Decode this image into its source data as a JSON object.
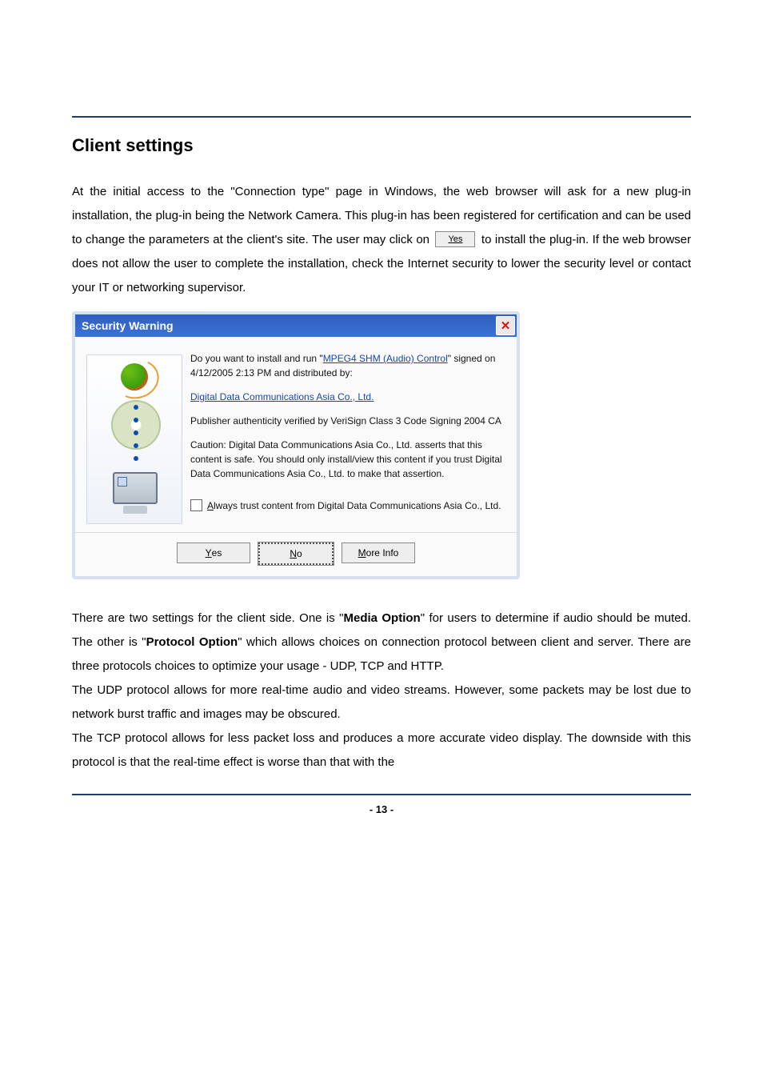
{
  "heading": "Client settings",
  "intro_before_button": "At the initial access to the \"Connection type\" page in Windows, the web browser will ask for a new plug-in installation, the plug-in being the Network Camera. This plug-in has been registered for certification and can be used to change the parameters at the client's site.   The user may click on ",
  "yes_button_inline": "Yes",
  "intro_after_button": " to install the plug-in. If the web browser does not allow the user to complete the installation, check the Internet security to lower the security level or contact your IT or networking supervisor.",
  "dialog": {
    "title": "Security Warning",
    "line1a": "Do you want to install and run \"",
    "link1": "MPEG4 SHM (Audio) Control",
    "line1b": "\" signed on 4/12/2005 2:13 PM and distributed by:",
    "link2": "Digital Data Communications Asia Co., Ltd.",
    "line2": "Publisher authenticity verified by VeriSign Class 3 Code Signing 2004 CA",
    "line3": "Caution: Digital Data Communications Asia Co., Ltd. asserts that this content is safe.  You should only install/view this content if you trust Digital Data Communications Asia Co., Ltd. to make that assertion.",
    "checkbox_label_a": "A",
    "checkbox_label_b": "lways trust content from Digital Data Communications Asia Co., Ltd.",
    "btn_yes_u": "Y",
    "btn_yes_r": "es",
    "btn_no_u": "N",
    "btn_no_r": "o",
    "btn_more_u": "M",
    "btn_more_r": "ore Info"
  },
  "p2a": "There are two settings for the client side. One is \"",
  "p2_strong1": "Media Option",
  "p2b": "\" for users to determine if audio should be muted. The other is \"",
  "p2_strong2": "Protocol Option",
  "p2c": "\" which allows choices on connection protocol between client and server. There are three protocols choices to optimize your usage - UDP, TCP and HTTP.",
  "p3": "The UDP protocol allows for more real-time audio and video streams. However, some packets may be lost due to network burst traffic and images may be obscured.",
  "p4": "The TCP protocol allows for less packet loss and produces a more accurate video display. The downside with this protocol is that the real-time effect is worse than that with the",
  "page_number": "- 13 -"
}
